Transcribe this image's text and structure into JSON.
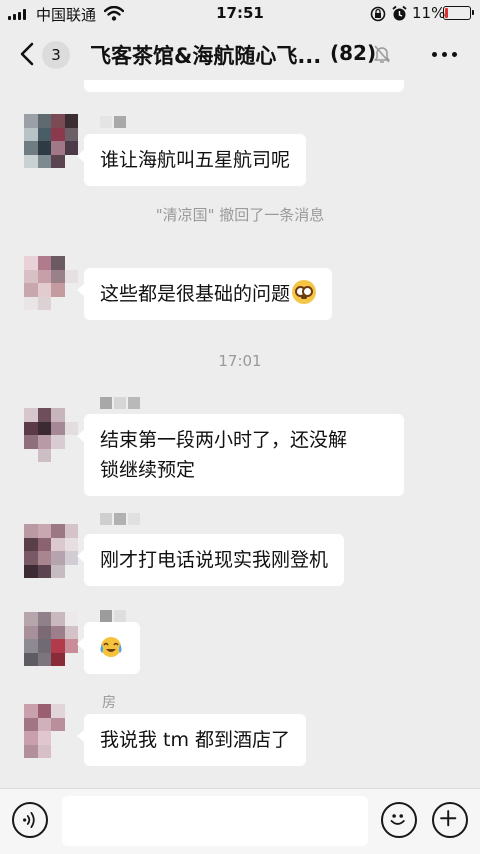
{
  "status_bar": {
    "carrier": "中国联通",
    "time": "17:51",
    "battery_percent": "11%",
    "battery_level": 0.11
  },
  "header": {
    "back_unread_count": "3",
    "title": "飞客茶馆&海航随心飞...",
    "member_count": "(82)"
  },
  "messages": [
    {
      "type": "text",
      "text": "谁让海航叫五星航司呢"
    },
    {
      "type": "system",
      "text": "\"清凉国\" 撤回了一条消息"
    },
    {
      "type": "text",
      "text": "这些都是很基础的问题",
      "emoji": "flushed-face-emoji"
    },
    {
      "type": "time",
      "text": "17:01"
    },
    {
      "type": "text",
      "lines": [
        "结束第一段两小时了，还没解",
        "锁继续预定"
      ]
    },
    {
      "type": "text",
      "text": "刚才打电话说现实我刚登机"
    },
    {
      "type": "sticker",
      "emoji": "crying-laughing-face-emoji"
    },
    {
      "type": "text",
      "text": "我说我 tm 都到酒店了",
      "sender_fragment": "房"
    }
  ],
  "input_bar": {
    "placeholder": "",
    "voice_icon": "voice-icon",
    "emoji_icon": "smiley-icon",
    "plus_icon": "plus-icon"
  },
  "colors": {
    "background": "#ededed",
    "bubble": "#ffffff",
    "system_text": "#9a9a9a",
    "battery_low": "#e03131"
  }
}
